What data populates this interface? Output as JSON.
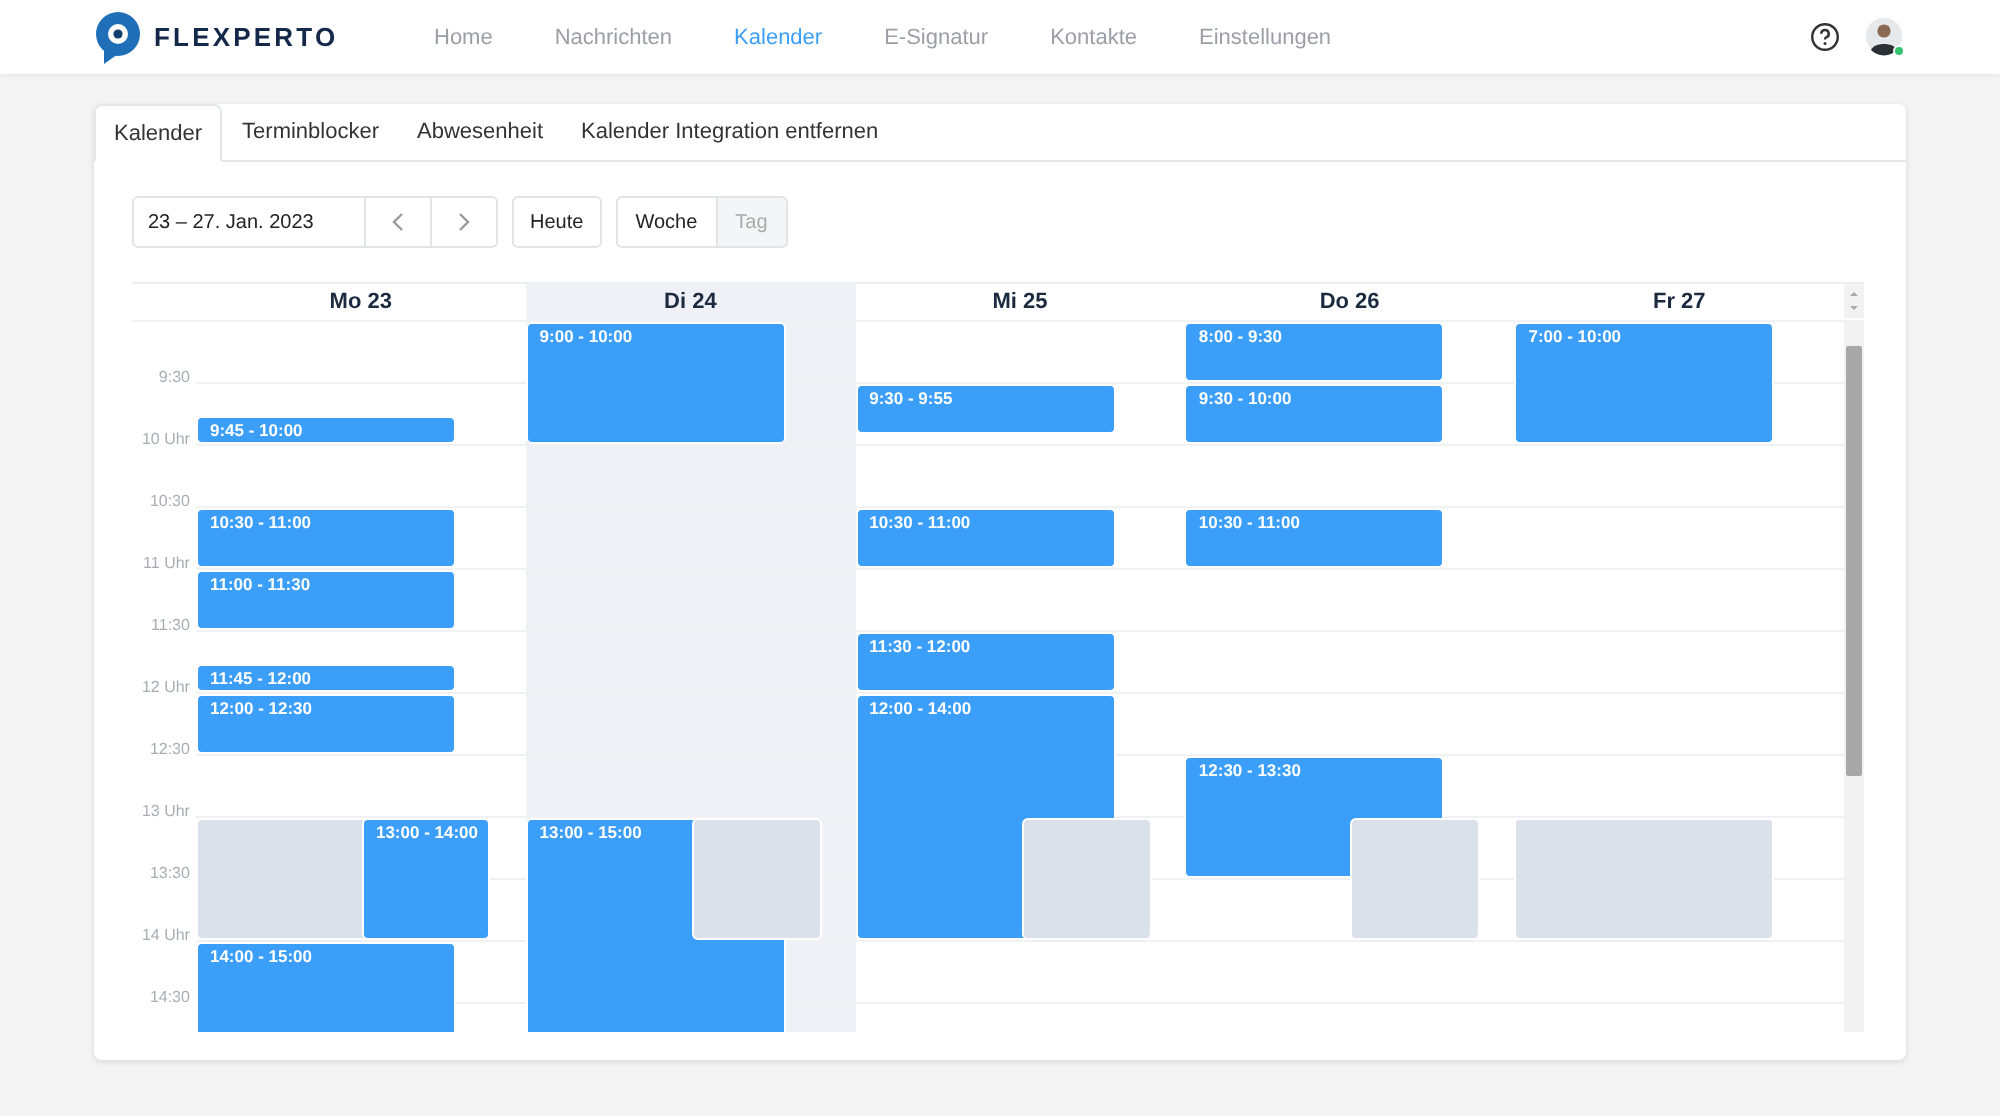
{
  "header": {
    "brand": "FLEXPERTO",
    "nav": [
      {
        "label": "Home",
        "selected": false
      },
      {
        "label": "Nachrichten",
        "selected": false
      },
      {
        "label": "Kalender",
        "selected": true
      },
      {
        "label": "E-Signatur",
        "selected": false
      },
      {
        "label": "Kontakte",
        "selected": false
      },
      {
        "label": "Einstellungen",
        "selected": false
      }
    ],
    "user": {
      "online": true
    }
  },
  "tabs": [
    {
      "label": "Kalender",
      "selected": true
    },
    {
      "label": "Terminblocker",
      "selected": false
    },
    {
      "label": "Abwesenheit",
      "selected": false
    },
    {
      "label": "Kalender Integration entfernen",
      "selected": false
    }
  ],
  "toolbar": {
    "date_range": "23 – 27. Jan. 2023",
    "today": "Heute",
    "views": [
      {
        "label": "Woche",
        "selected": true
      },
      {
        "label": "Tag",
        "selected": false
      }
    ]
  },
  "time_labels": [
    "9:30",
    "10 Uhr",
    "10:30",
    "11 Uhr",
    "11:30",
    "12 Uhr",
    "12:30",
    "13 Uhr",
    "13:30",
    "14 Uhr",
    "14:30"
  ],
  "days": [
    {
      "label": "Mo 23",
      "today": false,
      "blocked_slot": {
        "kind": "under"
      },
      "events": [
        {
          "label": "9:45 - 10:00",
          "shifted": false
        },
        {
          "label": "10:30 - 11:00",
          "shifted": false
        },
        {
          "label": "11:00 - 11:30",
          "shifted": false
        },
        {
          "label": "11:45 - 12:00",
          "shifted": false
        },
        {
          "label": "12:00 - 12:30",
          "shifted": false
        },
        {
          "label": "13:00 - 14:00",
          "shifted": true
        },
        {
          "label": "14:00 - 15:00",
          "shifted": false
        }
      ]
    },
    {
      "label": "Di 24",
      "today": true,
      "blocked_slot": {
        "kind": "over"
      },
      "events": [
        {
          "label": "9:00 - 10:00",
          "shifted": false
        },
        {
          "label": "13:00 - 15:00",
          "shifted": false
        }
      ]
    },
    {
      "label": "Mi 25",
      "today": false,
      "blocked_slot": {
        "kind": "over"
      },
      "events": [
        {
          "label": "9:30 - 9:55",
          "shifted": false
        },
        {
          "label": "10:30 - 11:00",
          "shifted": false
        },
        {
          "label": "11:30 - 12:00",
          "shifted": false
        },
        {
          "label": "12:00 - 14:00",
          "shifted": false
        }
      ]
    },
    {
      "label": "Do 26",
      "today": false,
      "blocked_slot": {
        "kind": "over"
      },
      "events": [
        {
          "label": "8:00 - 9:30",
          "shifted": false
        },
        {
          "label": "9:30 - 10:00",
          "shifted": false
        },
        {
          "label": "10:30 - 11:00",
          "shifted": false
        },
        {
          "label": "12:30 - 13:30",
          "shifted": false
        }
      ]
    },
    {
      "label": "Fr 27",
      "today": false,
      "blocked_slot": {
        "kind": "full"
      },
      "events": [
        {
          "label": "7:00 - 10:00",
          "shifted": false
        }
      ]
    }
  ]
}
